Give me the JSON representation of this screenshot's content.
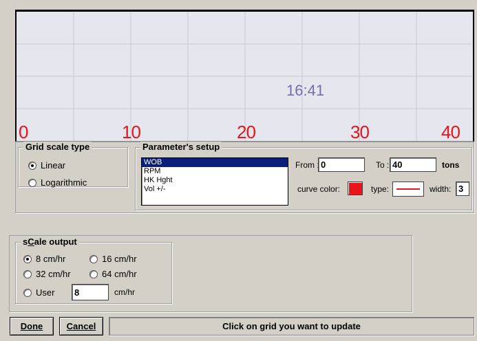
{
  "grid": {
    "time_label": "16:41",
    "scale_ticks": [
      "0",
      "10",
      "20",
      "30",
      "40"
    ]
  },
  "grid_scale_type": {
    "title": "Grid scale type",
    "options": [
      "Linear",
      "Logarithmic"
    ],
    "selected": "Linear"
  },
  "parameter_setup": {
    "title": "Parameter's setup",
    "parameters": [
      "WOB",
      "RPM",
      "HK Hght",
      "Vol +/-"
    ],
    "selected": "WOB",
    "from_label": "From :",
    "from_value": "0",
    "to_label": "To :",
    "to_value": "40",
    "unit": "tons",
    "curve_color_label": "curve color:",
    "curve_color": "#e8141c",
    "type_label": "type:",
    "width_label": "width:",
    "width_value": "3"
  },
  "scale_output": {
    "title": "sCale output",
    "options": [
      "8 cm/hr",
      "16 cm/hr",
      "32 cm/hr",
      "64 cm/hr",
      "User"
    ],
    "selected": "8 cm/hr",
    "user_value": "8",
    "user_unit": "cm/hr"
  },
  "footer": {
    "done_label": "Done",
    "cancel_label": "Cancel",
    "status_text": "Click on grid you want to update"
  }
}
